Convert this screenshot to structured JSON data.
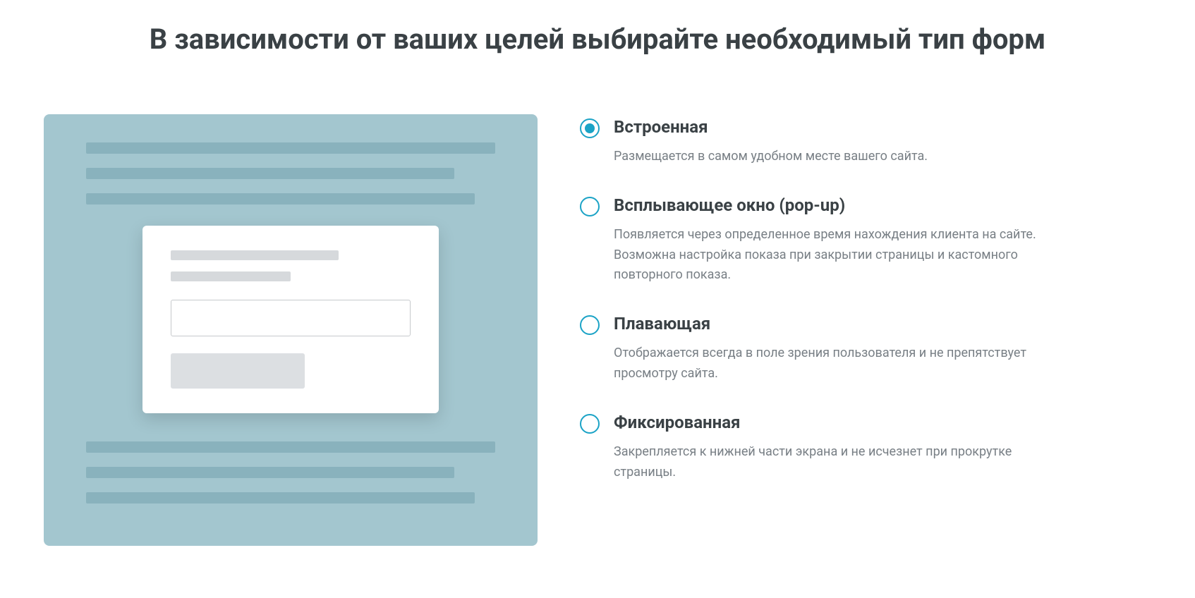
{
  "heading": "В зависимости от ваших целей выбирайте необходимый тип форм",
  "options": [
    {
      "title": "Встроенная",
      "description": "Размещается в самом удобном месте вашего сайта.",
      "selected": true
    },
    {
      "title": "Всплывающее окно (pop-up)",
      "description": "Появляется через определенное время нахождения клиента на сайте. Возможна настройка показа при закрытии страницы и кастомного повторного показа.",
      "selected": false
    },
    {
      "title": "Плавающая",
      "description": "Отображается всегда в поле зрения пользователя и не препятствует просмотру сайта.",
      "selected": false
    },
    {
      "title": "Фиксированная",
      "description": "Закрепляется к нижней части экрана и не исчезнет при прокрутке страницы.",
      "selected": false
    }
  ]
}
